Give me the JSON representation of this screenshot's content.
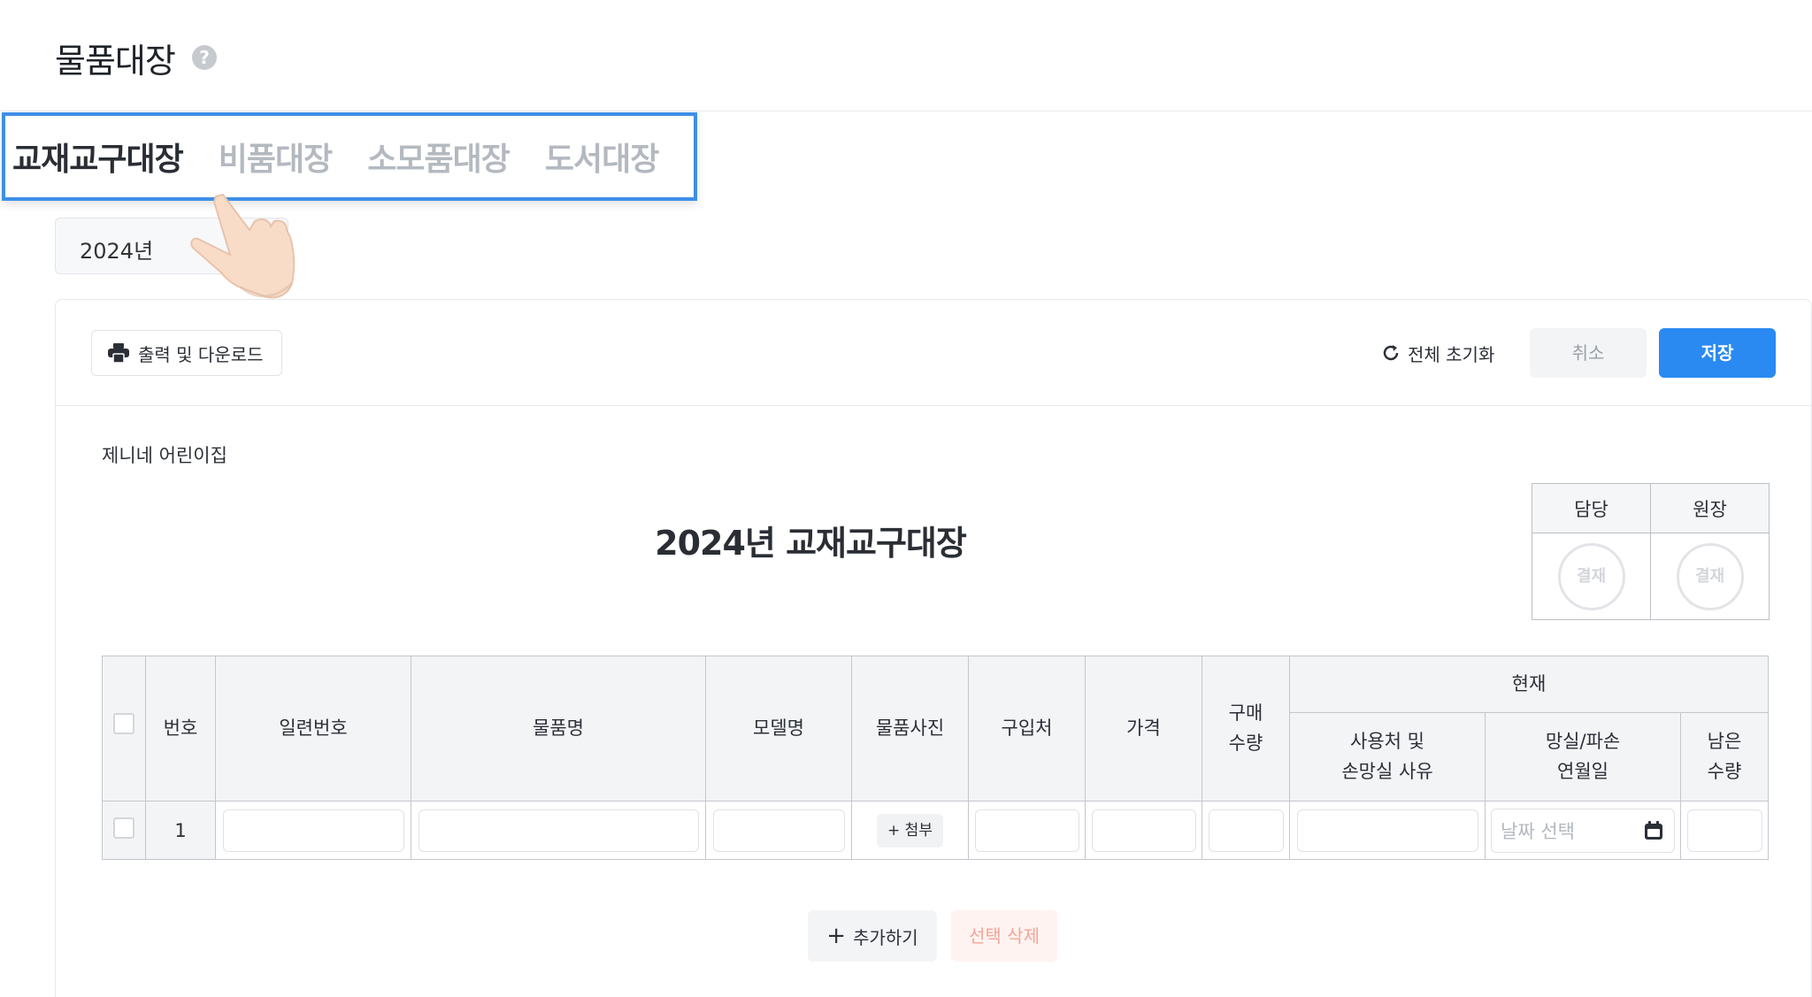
{
  "page": {
    "title": "물품대장",
    "help_icon": "?"
  },
  "tabs": [
    {
      "label": "교재교구대장",
      "active": true
    },
    {
      "label": "비품대장",
      "active": false
    },
    {
      "label": "소모품대장",
      "active": false
    },
    {
      "label": "도서대장",
      "active": false
    }
  ],
  "year_select": {
    "value": "2024년"
  },
  "toolbar": {
    "print_label": "출력 및 다운로드",
    "reset_label": "전체 초기화",
    "cancel_label": "취소",
    "save_label": "저장"
  },
  "document": {
    "org_name": "제니네 어린이집",
    "title": "2024년 교재교구대장"
  },
  "approval": {
    "headers": [
      "담당",
      "원장"
    ],
    "stamp_label": "결재"
  },
  "table": {
    "headers": {
      "number": "번호",
      "serial": "일련번호",
      "name": "물품명",
      "model": "모델명",
      "photo": "물품사진",
      "vendor": "구입처",
      "price": "가격",
      "qty_line1": "구매",
      "qty_line2": "수량",
      "current": "현재",
      "usage_line1": "사용처 및",
      "usage_line2": "손망실 사유",
      "loss_line1": "망실/파손",
      "loss_line2": "연월일",
      "remain_line1": "남은",
      "remain_line2": "수량"
    },
    "rows": [
      {
        "number": "1",
        "attach_label": "+ 첨부",
        "date_placeholder": "날짜 선택"
      }
    ]
  },
  "actions": {
    "add_label": "추가하기",
    "delete_label": "선택 삭제"
  },
  "colors": {
    "accent": "#2a8af2",
    "tab_highlight": "#3d8fe6",
    "delete_text": "#f4a497"
  }
}
